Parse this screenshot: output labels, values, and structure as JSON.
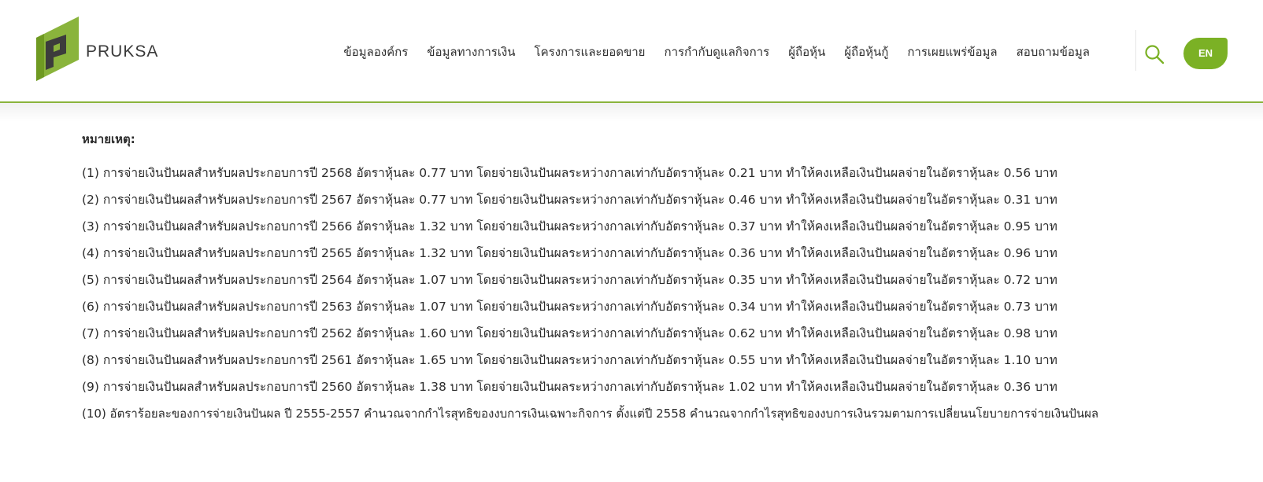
{
  "brand": {
    "name": "PRUKSA",
    "accent_color": "#7bb125",
    "dark_color": "#3a3a3a"
  },
  "nav": {
    "items": [
      "ข้อมูลองค์กร",
      "ข้อมูลทางการเงิน",
      "โครงการและยอดขาย",
      "การกำกับดูแลกิจการ",
      "ผู้ถือหุ้น",
      "ผู้ถือหุ้นกู้",
      "การเผยแพร่ข้อมูล",
      "สอบถามข้อมูล"
    ],
    "search_icon": "search-icon",
    "language": "EN"
  },
  "notes": {
    "title": "หมายเหตุ:",
    "items": [
      "(1) การจ่ายเงินปันผลสำหรับผลประกอบการปี 2568 อัตราหุ้นละ 0.77 บาท โดยจ่ายเงินปันผลระหว่างกาลเท่ากับอัตราหุ้นละ 0.21 บาท ทำให้คงเหลือเงินปันผลจ่ายในอัตราหุ้นละ 0.56 บาท",
      "(2) การจ่ายเงินปันผลสำหรับผลประกอบการปี 2567 อัตราหุ้นละ 0.77 บาท โดยจ่ายเงินปันผลระหว่างกาลเท่ากับอัตราหุ้นละ 0.46 บาท ทำให้คงเหลือเงินปันผลจ่ายในอัตราหุ้นละ 0.31 บาท",
      "(3) การจ่ายเงินปันผลสำหรับผลประกอบการปี 2566 อัตราหุ้นละ 1.32 บาท โดยจ่ายเงินปันผลระหว่างกาลเท่ากับอัตราหุ้นละ 0.37 บาท ทำให้คงเหลือเงินปันผลจ่ายในอัตราหุ้นละ 0.95 บาท",
      "(4) การจ่ายเงินปันผลสำหรับผลประกอบการปี 2565 อัตราหุ้นละ 1.32 บาท โดยจ่ายเงินปันผลระหว่างกาลเท่ากับอัตราหุ้นละ 0.36 บาท ทำให้คงเหลือเงินปันผลจ่ายในอัตราหุ้นละ 0.96 บาท",
      "(5) การจ่ายเงินปันผลสำหรับผลประกอบการปี 2564 อัตราหุ้นละ 1.07 บาท โดยจ่ายเงินปันผลระหว่างกาลเท่ากับอัตราหุ้นละ 0.35 บาท ทำให้คงเหลือเงินปันผลจ่ายในอัตราหุ้นละ 0.72 บาท",
      "(6) การจ่ายเงินปันผลสำหรับผลประกอบการปี 2563 อัตราหุ้นละ 1.07 บาท โดยจ่ายเงินปันผลระหว่างกาลเท่ากับอัตราหุ้นละ 0.34 บาท ทำให้คงเหลือเงินปันผลจ่ายในอัตราหุ้นละ 0.73 บาท",
      "(7) การจ่ายเงินปันผลสำหรับผลประกอบการปี 2562 อัตราหุ้นละ 1.60 บาท โดยจ่ายเงินปันผลระหว่างกาลเท่ากับอัตราหุ้นละ 0.62 บาท ทำให้คงเหลือเงินปันผลจ่ายในอัตราหุ้นละ 0.98 บาท",
      "(8) การจ่ายเงินปันผลสำหรับผลประกอบการปี 2561 อัตราหุ้นละ 1.65 บาท โดยจ่ายเงินปันผลระหว่างกาลเท่ากับอัตราหุ้นละ 0.55 บาท ทำให้คงเหลือเงินปันผลจ่ายในอัตราหุ้นละ 1.10 บาท",
      "(9) การจ่ายเงินปันผลสำหรับผลประกอบการปี 2560 อัตราหุ้นละ 1.38 บาท โดยจ่ายเงินปันผลระหว่างกาลเท่ากับอัตราหุ้นละ 1.02 บาท ทำให้คงเหลือเงินปันผลจ่ายในอัตราหุ้นละ 0.36 บาท",
      "(10) อัตราร้อยละของการจ่ายเงินปันผล ปี 2555-2557 คำนวณจากกำไรสุทธิของงบการเงินเฉพาะกิจการ ตั้งแต่ปี 2558 คำนวณจากกำไรสุทธิของงบการเงินรวมตามการเปลี่ยนนโยบายการจ่ายเงินปันผล"
    ]
  }
}
